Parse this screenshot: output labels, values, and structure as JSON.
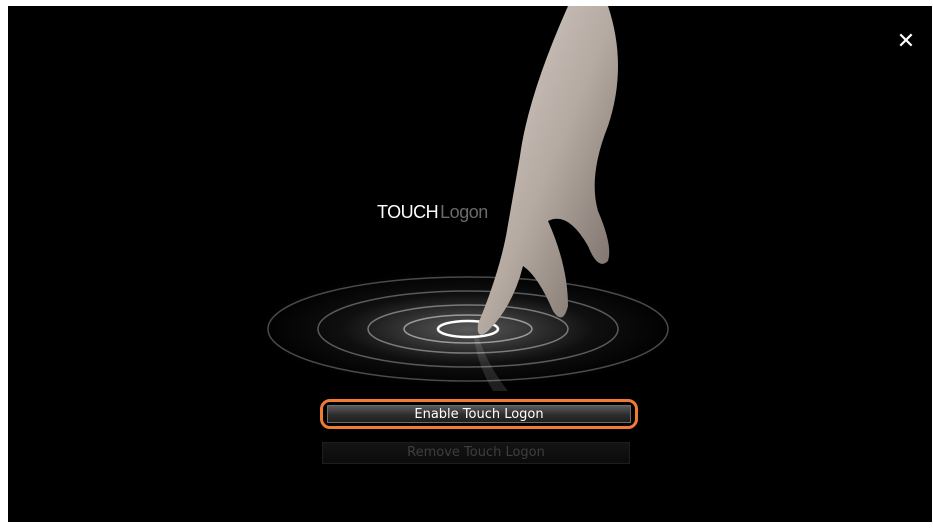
{
  "window": {
    "close_icon": "close-icon",
    "close_glyph": "✕"
  },
  "logo": {
    "word_a": "TOUCH",
    "word_b": "Logon"
  },
  "buttons": {
    "enable_label": "Enable Touch Logon",
    "remove_label": "Remove Touch Logon"
  },
  "colors": {
    "background": "#000000",
    "highlight": "#f07b35"
  }
}
